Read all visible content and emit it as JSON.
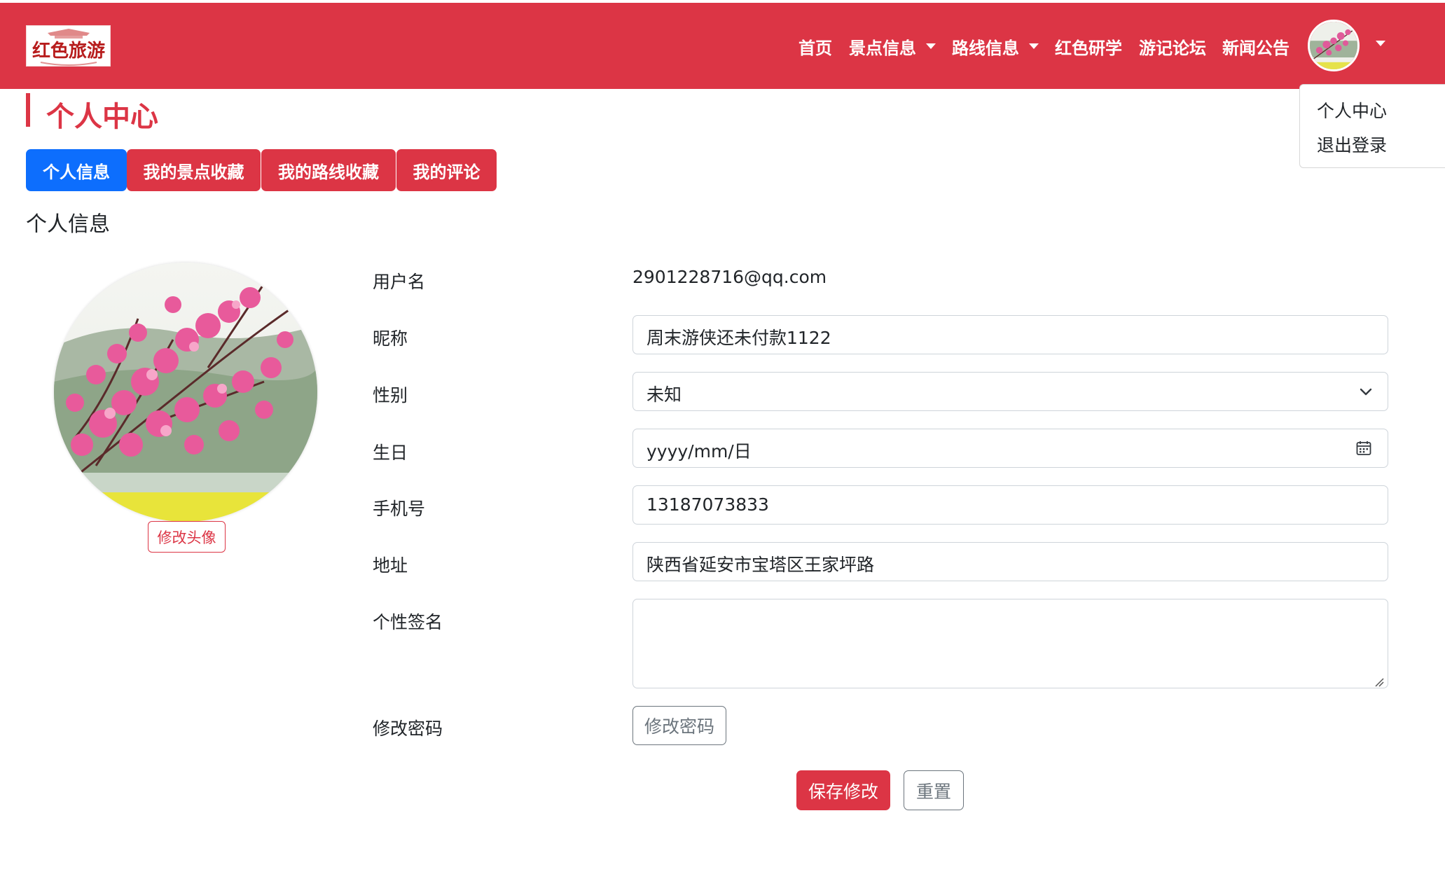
{
  "brand": {
    "logo_text": "红色旅游",
    "accent": "#dc3545",
    "primary": "#0d6efd"
  },
  "navbar": {
    "items": [
      {
        "label": "首页",
        "has_dropdown": false
      },
      {
        "label": "景点信息",
        "has_dropdown": true
      },
      {
        "label": "路线信息",
        "has_dropdown": true
      },
      {
        "label": "红色研学",
        "has_dropdown": false
      },
      {
        "label": "游记论坛",
        "has_dropdown": false
      },
      {
        "label": "新闻公告",
        "has_dropdown": false
      }
    ],
    "user_menu": {
      "items": [
        "个人中心",
        "退出登录"
      ]
    }
  },
  "page": {
    "title": "个人中心"
  },
  "tabs": [
    {
      "label": "个人信息",
      "active": true
    },
    {
      "label": "我的景点收藏",
      "active": false
    },
    {
      "label": "我的路线收藏",
      "active": false
    },
    {
      "label": "我的评论",
      "active": false
    }
  ],
  "profile": {
    "section_title": "个人信息",
    "change_avatar_label": "修改头像",
    "labels": {
      "username": "用户名",
      "nickname": "昵称",
      "gender": "性别",
      "birthday": "生日",
      "phone": "手机号",
      "address": "地址",
      "signature": "个性签名",
      "password": "修改密码"
    },
    "values": {
      "username": "2901228716@qq.com",
      "nickname": "周末游侠还未付款1122",
      "gender": "未知",
      "birthday": "yyyy/mm/日",
      "phone": "13187073833",
      "address": "陕西省延安市宝塔区王家坪路",
      "signature": ""
    },
    "change_password_button": "修改密码",
    "save_button": "保存修改",
    "reset_button": "重置"
  }
}
